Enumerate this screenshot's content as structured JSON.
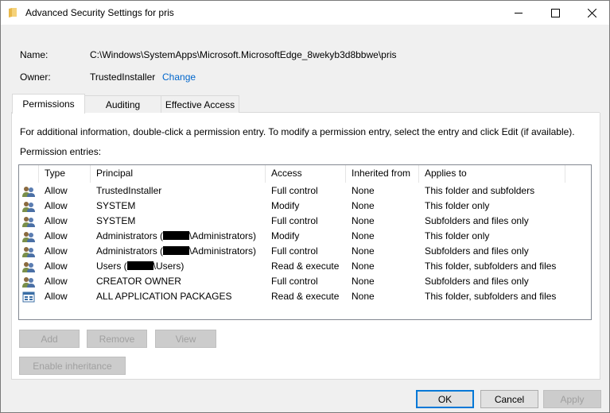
{
  "window": {
    "title": "Advanced Security Settings for pris",
    "folder_icon": "folder-icon",
    "controls": [
      "minimize-icon",
      "maximize-icon",
      "close-icon"
    ]
  },
  "info": {
    "name_label": "Name:",
    "name_value": "C:\\Windows\\SystemApps\\Microsoft.MicrosoftEdge_8wekyb3d8bbwe\\pris",
    "owner_label": "Owner:",
    "owner_value": "TrustedInstaller",
    "owner_change": "Change"
  },
  "tabs": [
    {
      "label": "Permissions",
      "active": true
    },
    {
      "label": "Auditing",
      "active": false
    },
    {
      "label": "Effective Access",
      "active": false
    }
  ],
  "permissions": {
    "info_text": "For additional information, double-click a permission entry. To modify a permission entry, select the entry and click Edit (if available).",
    "entries_label": "Permission entries:",
    "columns": [
      "Type",
      "Principal",
      "Access",
      "Inherited from",
      "Applies to"
    ],
    "rows": [
      {
        "icon": "users-icon",
        "type": "Allow",
        "principal": "TrustedInstaller",
        "access": "Full control",
        "inherited": "None",
        "applies": "This folder and subfolders"
      },
      {
        "icon": "users-icon",
        "type": "Allow",
        "principal": "SYSTEM",
        "access": "Modify",
        "inherited": "None",
        "applies": "This folder only"
      },
      {
        "icon": "users-icon",
        "type": "Allow",
        "principal": "SYSTEM",
        "access": "Full control",
        "inherited": "None",
        "applies": "Subfolders and files only"
      },
      {
        "icon": "users-icon",
        "type": "Allow",
        "principal_pre": "Administrators (",
        "principal_post": "\\Administrators)",
        "redacted": true,
        "access": "Modify",
        "inherited": "None",
        "applies": "This folder only"
      },
      {
        "icon": "users-icon",
        "type": "Allow",
        "principal_pre": "Administrators (",
        "principal_post": "\\Administrators)",
        "redacted": true,
        "access": "Full control",
        "inherited": "None",
        "applies": "Subfolders and files only"
      },
      {
        "icon": "users-icon",
        "type": "Allow",
        "principal_pre": "Users (",
        "principal_post": "\\Users)",
        "redacted": true,
        "access": "Read & execute",
        "inherited": "None",
        "applies": "This folder, subfolders and files"
      },
      {
        "icon": "users-icon",
        "type": "Allow",
        "principal": "CREATOR OWNER",
        "access": "Full control",
        "inherited": "None",
        "applies": "Subfolders and files only"
      },
      {
        "icon": "app-packages-icon",
        "type": "Allow",
        "principal": "ALL APPLICATION PACKAGES",
        "access": "Read & execute",
        "inherited": "None",
        "applies": "This folder, subfolders and files"
      }
    ],
    "buttons": {
      "add": "Add",
      "remove": "Remove",
      "view": "View",
      "enable_inheritance": "Enable inheritance"
    }
  },
  "footer": {
    "ok": "OK",
    "cancel": "Cancel",
    "apply": "Apply"
  }
}
